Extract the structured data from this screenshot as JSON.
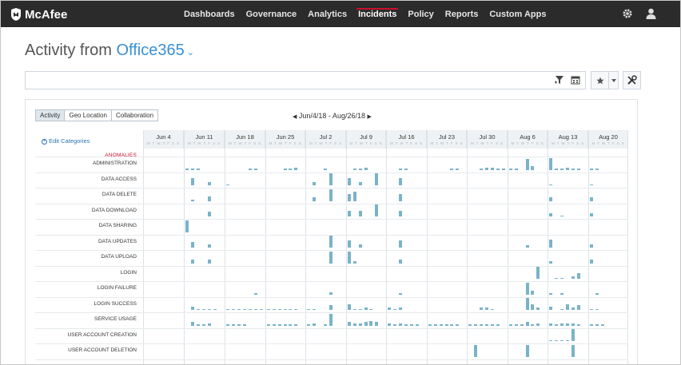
{
  "brand": {
    "name": "McAfee"
  },
  "nav": {
    "items": [
      "Dashboards",
      "Governance",
      "Analytics",
      "Incidents",
      "Policy",
      "Reports",
      "Custom Apps"
    ],
    "active": "Incidents"
  },
  "page": {
    "title_prefix": "Activity from",
    "source": "Office365"
  },
  "tabs": [
    "Activity",
    "Geo Location",
    "Collaboration"
  ],
  "active_tab": "Activity",
  "date_range": "Jun/4/18 - Aug/26/18",
  "edit_categories": "Edit Categories",
  "anomalies_label": "ANOMALIES",
  "days_label": "M T W T F S S",
  "weeks": [
    "Jun 4",
    "Jun 11",
    "Jun 18",
    "Jun 25",
    "Jul 2",
    "Jul 9",
    "Jul 16",
    "Jul 23",
    "Jul 30",
    "Aug 6",
    "Aug 13",
    "Aug 20"
  ],
  "rows": [
    "ADMINISTRATION",
    "DATA ACCESS",
    "DATA DELETE",
    "DATA DOWNLOAD",
    "DATA SHARING",
    "DATA UPDATES",
    "DATA UPLOAD",
    "LOGIN",
    "LOGIN FAILURE",
    "LOGIN SUCCESS",
    "SERVICE USAGE",
    "USER ACCOUNT CREATION",
    "USER ACCOUNT DELETION"
  ],
  "colors": {
    "bar": "#7ab3c8",
    "accent": "#3a8fd4",
    "alert": "#c8102e",
    "topbar": "#2b2b2b"
  },
  "icons": {
    "filter": "filter-icon",
    "calendar": "calendar-icon",
    "star": "star-icon",
    "tools": "tools-icon",
    "settings": "gear-icon",
    "user": "user-icon"
  },
  "activity": {
    "ADMINISTRATION": [
      [
        1,
        0,
        0.1
      ],
      [
        1,
        1,
        0.1
      ],
      [
        1,
        2,
        0.1
      ],
      [
        2,
        4,
        0.1
      ],
      [
        2,
        5,
        0.1
      ],
      [
        3,
        3,
        0.1
      ],
      [
        3,
        4,
        0.1
      ],
      [
        3,
        5,
        0.15
      ],
      [
        4,
        3,
        0.1
      ],
      [
        5,
        1,
        0.1
      ],
      [
        5,
        2,
        0.1
      ],
      [
        5,
        3,
        0.2
      ],
      [
        6,
        2,
        0.1
      ],
      [
        6,
        3,
        0.1
      ],
      [
        7,
        4,
        0.1
      ],
      [
        7,
        5,
        0.1
      ],
      [
        8,
        2,
        0.1
      ],
      [
        8,
        3,
        0.15
      ],
      [
        8,
        4,
        0.2
      ],
      [
        8,
        5,
        0.1
      ],
      [
        8,
        6,
        0.1
      ],
      [
        9,
        0,
        0.1
      ],
      [
        9,
        1,
        0.1
      ],
      [
        9,
        3,
        0.9
      ],
      [
        9,
        4,
        0.3
      ],
      [
        10,
        0,
        1.0
      ],
      [
        10,
        1,
        0.1
      ],
      [
        10,
        2,
        0.1
      ],
      [
        10,
        3,
        0.2
      ],
      [
        10,
        4,
        0.1
      ],
      [
        10,
        5,
        0.1
      ],
      [
        11,
        0,
        0.1
      ],
      [
        11,
        1,
        0.1
      ]
    ],
    "DATA ACCESS": [
      [
        1,
        1,
        0.6
      ],
      [
        1,
        4,
        0.3
      ],
      [
        2,
        0,
        0.1
      ],
      [
        4,
        1,
        0.3
      ],
      [
        4,
        4,
        1.0
      ],
      [
        5,
        0,
        0.6
      ],
      [
        5,
        2,
        0.3
      ],
      [
        5,
        5,
        1.0
      ],
      [
        6,
        2,
        0.6
      ],
      [
        10,
        0,
        0.1
      ],
      [
        11,
        0,
        0.1
      ]
    ],
    "DATA DELETE": [
      [
        1,
        1,
        0.1
      ],
      [
        1,
        4,
        0.4
      ],
      [
        4,
        1,
        0.3
      ],
      [
        4,
        4,
        1.0
      ],
      [
        5,
        0,
        0.6
      ],
      [
        5,
        1,
        0.8
      ],
      [
        6,
        2,
        0.6
      ],
      [
        10,
        0,
        0.3
      ],
      [
        11,
        0,
        0.3
      ]
    ],
    "DATA DOWNLOAD": [
      [
        1,
        4,
        0.4
      ],
      [
        5,
        0,
        0.5
      ],
      [
        5,
        2,
        0.5
      ],
      [
        5,
        5,
        1.0
      ],
      [
        6,
        2,
        0.5
      ],
      [
        10,
        0,
        0.3
      ],
      [
        10,
        2,
        0.1
      ],
      [
        11,
        0,
        0.3
      ]
    ],
    "DATA SHARING": [
      [
        1,
        0,
        1.0
      ]
    ],
    "DATA UPDATES": [
      [
        1,
        1,
        0.5
      ],
      [
        1,
        4,
        0.3
      ],
      [
        4,
        4,
        1.0
      ],
      [
        5,
        0,
        0.6
      ],
      [
        5,
        2,
        0.3
      ],
      [
        6,
        2,
        0.6
      ],
      [
        9,
        3,
        0.2
      ],
      [
        10,
        0,
        0.7
      ],
      [
        11,
        0,
        0.3
      ]
    ],
    "DATA UPLOAD": [
      [
        1,
        1,
        0.3
      ],
      [
        1,
        4,
        0.3
      ],
      [
        4,
        4,
        1.0
      ],
      [
        5,
        0,
        1.0
      ],
      [
        5,
        1,
        0.2
      ],
      [
        6,
        2,
        0.3
      ],
      [
        10,
        0,
        0.2
      ],
      [
        11,
        0,
        0.3
      ]
    ],
    "LOGIN": [
      [
        9,
        5,
        1.0
      ],
      [
        10,
        1,
        0.1
      ],
      [
        10,
        2,
        0.1
      ],
      [
        10,
        4,
        0.2
      ],
      [
        10,
        5,
        0.5
      ]
    ],
    "LOGIN FAILURE": [
      [
        2,
        5,
        0.1
      ],
      [
        4,
        4,
        0.2
      ],
      [
        6,
        2,
        0.1
      ],
      [
        9,
        3,
        1.0
      ],
      [
        9,
        4,
        0.3
      ],
      [
        10,
        0,
        0.1
      ],
      [
        10,
        2,
        0.1
      ],
      [
        11,
        1,
        0.1
      ]
    ],
    "LOGIN SUCCESS": [
      [
        1,
        1,
        0.3
      ],
      [
        1,
        2,
        0.1
      ],
      [
        1,
        3,
        0.1
      ],
      [
        1,
        4,
        0.1
      ],
      [
        1,
        5,
        0.1
      ],
      [
        2,
        0,
        0.1
      ],
      [
        2,
        1,
        0.1
      ],
      [
        2,
        2,
        0.1
      ],
      [
        2,
        3,
        0.1
      ],
      [
        2,
        4,
        0.1
      ],
      [
        2,
        5,
        0.1
      ],
      [
        2,
        6,
        0.1
      ],
      [
        3,
        0,
        0.1
      ],
      [
        3,
        1,
        0.1
      ],
      [
        3,
        2,
        0.1
      ],
      [
        3,
        3,
        0.1
      ],
      [
        3,
        4,
        0.1
      ],
      [
        3,
        5,
        0.1
      ],
      [
        4,
        0,
        0.1
      ],
      [
        4,
        1,
        0.1
      ],
      [
        4,
        4,
        0.4
      ],
      [
        5,
        0,
        0.5
      ],
      [
        5,
        1,
        0.1
      ],
      [
        5,
        2,
        0.1
      ],
      [
        5,
        3,
        0.2
      ],
      [
        5,
        4,
        0.1
      ],
      [
        6,
        0,
        0.2
      ],
      [
        6,
        1,
        0.1
      ],
      [
        6,
        2,
        0.2
      ],
      [
        8,
        2,
        0.2
      ],
      [
        8,
        3,
        0.2
      ],
      [
        8,
        4,
        0.1
      ],
      [
        9,
        3,
        1.0
      ],
      [
        9,
        4,
        0.5
      ],
      [
        9,
        5,
        0.2
      ],
      [
        10,
        0,
        0.3
      ],
      [
        10,
        2,
        0.1
      ],
      [
        10,
        3,
        0.5
      ],
      [
        10,
        4,
        0.2
      ],
      [
        10,
        5,
        0.4
      ],
      [
        11,
        0,
        0.1
      ],
      [
        11,
        1,
        0.1
      ]
    ],
    "SERVICE USAGE": [
      [
        1,
        1,
        0.3
      ],
      [
        1,
        2,
        0.1
      ],
      [
        1,
        3,
        0.1
      ],
      [
        1,
        4,
        0.2
      ],
      [
        2,
        0,
        0.1
      ],
      [
        2,
        1,
        0.1
      ],
      [
        2,
        2,
        0.1
      ],
      [
        2,
        3,
        0.1
      ],
      [
        3,
        0,
        0.1
      ],
      [
        3,
        1,
        0.1
      ],
      [
        3,
        2,
        0.1
      ],
      [
        3,
        3,
        0.1
      ],
      [
        3,
        4,
        0.1
      ],
      [
        3,
        5,
        0.1
      ],
      [
        4,
        0,
        0.1
      ],
      [
        4,
        1,
        0.2
      ],
      [
        4,
        3,
        0.1
      ],
      [
        4,
        4,
        1.0
      ],
      [
        5,
        0,
        0.3
      ],
      [
        5,
        1,
        0.2
      ],
      [
        5,
        2,
        0.2
      ],
      [
        5,
        3,
        0.3
      ],
      [
        5,
        4,
        0.4
      ],
      [
        5,
        5,
        0.3
      ],
      [
        6,
        0,
        0.2
      ],
      [
        6,
        1,
        0.1
      ],
      [
        6,
        2,
        0.2
      ],
      [
        6,
        3,
        0.1
      ],
      [
        6,
        4,
        0.1
      ],
      [
        6,
        5,
        0.1
      ],
      [
        7,
        0,
        0.1
      ],
      [
        7,
        1,
        0.1
      ],
      [
        7,
        2,
        0.1
      ],
      [
        7,
        3,
        0.1
      ],
      [
        7,
        4,
        0.1
      ],
      [
        7,
        5,
        0.1
      ],
      [
        8,
        0,
        0.1
      ],
      [
        8,
        1,
        0.1
      ],
      [
        8,
        2,
        0.1
      ],
      [
        8,
        3,
        0.1
      ],
      [
        8,
        4,
        0.1
      ],
      [
        8,
        5,
        0.1
      ],
      [
        9,
        0,
        0.1
      ],
      [
        9,
        1,
        0.1
      ],
      [
        9,
        2,
        0.1
      ],
      [
        9,
        3,
        0.3
      ],
      [
        9,
        4,
        0.1
      ],
      [
        9,
        5,
        0.2
      ],
      [
        10,
        0,
        0.2
      ],
      [
        10,
        1,
        0.1
      ],
      [
        10,
        2,
        0.2
      ],
      [
        10,
        3,
        0.2
      ],
      [
        10,
        4,
        0.2
      ],
      [
        10,
        5,
        0.1
      ],
      [
        11,
        0,
        0.1
      ],
      [
        11,
        1,
        0.1
      ],
      [
        11,
        2,
        0.1
      ]
    ],
    "USER ACCOUNT CREATION": [
      [
        10,
        0,
        0.1
      ],
      [
        10,
        1,
        0.1
      ],
      [
        10,
        2,
        0.1
      ],
      [
        10,
        3,
        0.1
      ],
      [
        10,
        4,
        1.0
      ]
    ],
    "USER ACCOUNT DELETION": [
      [
        8,
        1,
        1.0
      ],
      [
        9,
        3,
        1.0
      ],
      [
        10,
        4,
        1.0
      ]
    ]
  }
}
